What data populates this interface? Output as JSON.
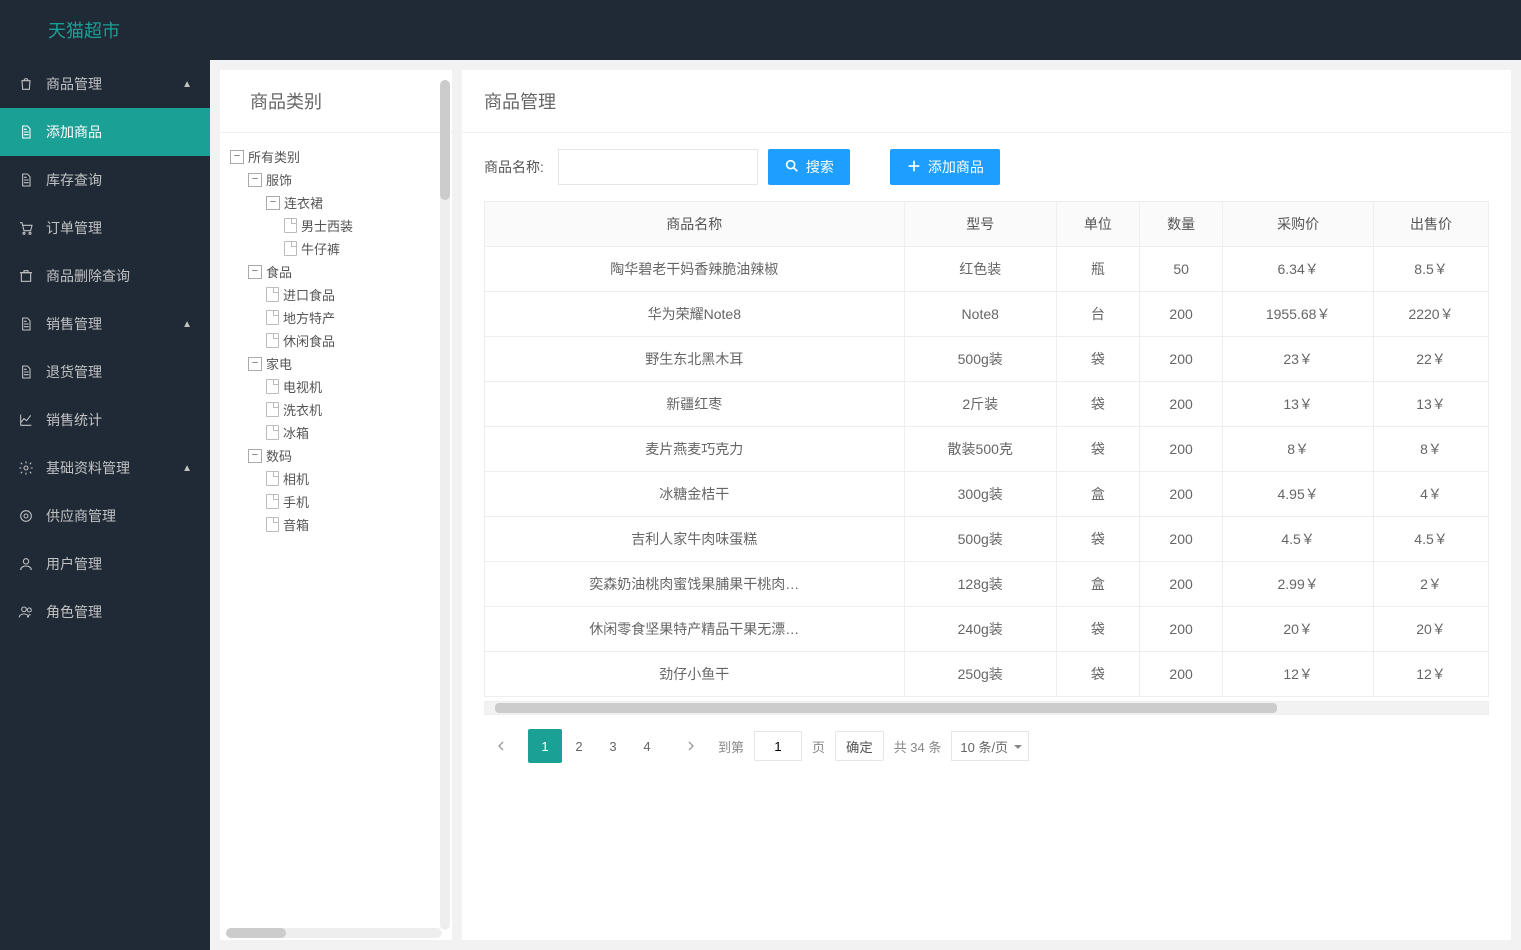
{
  "header": {
    "logo": "天猫超市"
  },
  "sidebar": {
    "groups": [
      {
        "label": "商品管理",
        "icon": "bag",
        "expanded": true,
        "items": [
          {
            "label": "添加商品",
            "icon": "doc",
            "active": true
          },
          {
            "label": "库存查询",
            "icon": "doc"
          },
          {
            "label": "订单管理",
            "icon": "cart"
          },
          {
            "label": "商品删除查询",
            "icon": "trash"
          }
        ]
      },
      {
        "label": "销售管理",
        "icon": "doc",
        "expanded": true,
        "items": [
          {
            "label": "退货管理",
            "icon": "doc"
          },
          {
            "label": "销售统计",
            "icon": "chart"
          }
        ]
      },
      {
        "label": "基础资料管理",
        "icon": "gear",
        "expanded": true,
        "items": [
          {
            "label": "供应商管理",
            "icon": "target"
          },
          {
            "label": "用户管理",
            "icon": "user"
          },
          {
            "label": "角色管理",
            "icon": "users"
          }
        ]
      }
    ]
  },
  "tree": {
    "title": "商品类别",
    "root": {
      "label": "所有类别",
      "children": [
        {
          "label": "服饰",
          "children": [
            {
              "label": "连衣裙",
              "children": [
                {
                  "label": "男士西装",
                  "leaf": true
                },
                {
                  "label": "牛仔裤",
                  "leaf": true
                }
              ]
            }
          ]
        },
        {
          "label": "食品",
          "children": [
            {
              "label": "进口食品",
              "leaf": true
            },
            {
              "label": "地方特产",
              "leaf": true
            },
            {
              "label": "休闲食品",
              "leaf": true
            }
          ]
        },
        {
          "label": "家电",
          "children": [
            {
              "label": "电视机",
              "leaf": true
            },
            {
              "label": "洗衣机",
              "leaf": true
            },
            {
              "label": "冰箱",
              "leaf": true
            }
          ]
        },
        {
          "label": "数码",
          "children": [
            {
              "label": "相机",
              "leaf": true
            },
            {
              "label": "手机",
              "leaf": true
            },
            {
              "label": "音箱",
              "leaf": true
            }
          ]
        }
      ]
    }
  },
  "content": {
    "title": "商品管理",
    "search_label": "商品名称:",
    "search_value": "",
    "search_btn": "搜索",
    "add_btn": "添加商品",
    "columns": [
      "商品名称",
      "型号",
      "单位",
      "数量",
      "采购价",
      "出售价"
    ],
    "rows": [
      [
        "陶华碧老干妈香辣脆油辣椒",
        "红色装",
        "瓶",
        "50",
        "6.34￥",
        "8.5￥"
      ],
      [
        "华为荣耀Note8",
        "Note8",
        "台",
        "200",
        "1955.68￥",
        "2220￥"
      ],
      [
        "野生东北黑木耳",
        "500g装",
        "袋",
        "200",
        "23￥",
        "22￥"
      ],
      [
        "新疆红枣",
        "2斤装",
        "袋",
        "200",
        "13￥",
        "13￥"
      ],
      [
        "麦片燕麦巧克力",
        "散装500克",
        "袋",
        "200",
        "8￥",
        "8￥"
      ],
      [
        "冰糖金桔干",
        "300g装",
        "盒",
        "200",
        "4.95￥",
        "4￥"
      ],
      [
        "吉利人家牛肉味蛋糕",
        "500g装",
        "袋",
        "200",
        "4.5￥",
        "4.5￥"
      ],
      [
        "奕森奶油桃肉蜜饯果脯果干桃肉…",
        "128g装",
        "盒",
        "200",
        "2.99￥",
        "2￥"
      ],
      [
        "休闲零食坚果特产精品干果无漂…",
        "240g装",
        "袋",
        "200",
        "20￥",
        "20￥"
      ],
      [
        "劲仔小鱼干",
        "250g装",
        "袋",
        "200",
        "12￥",
        "12￥"
      ]
    ]
  },
  "pager": {
    "pages": [
      "1",
      "2",
      "3",
      "4"
    ],
    "current": "1",
    "goto_label": "到第",
    "goto_value": "1",
    "goto_unit": "页",
    "confirm": "确定",
    "total": "共 34 条",
    "per_page": "10 条/页"
  }
}
